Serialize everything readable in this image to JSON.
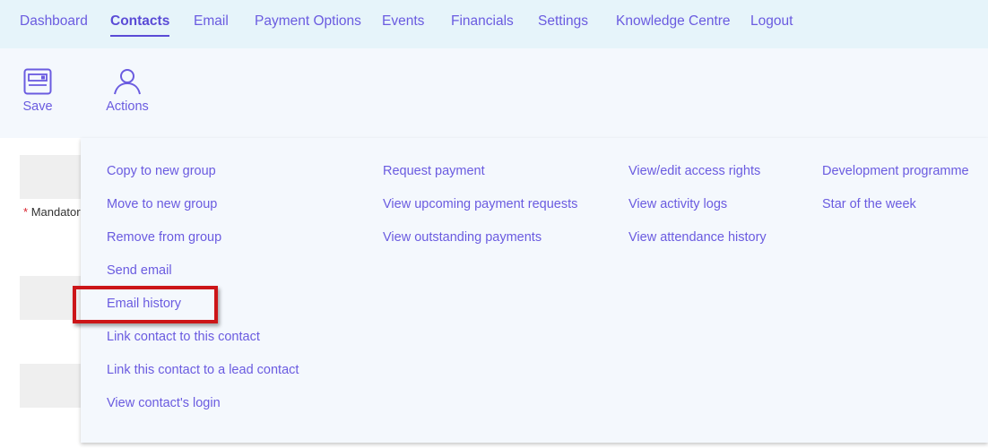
{
  "nav": {
    "dashboard": "Dashboard",
    "contacts": "Contacts",
    "email": "Email",
    "payment_options": "Payment Options",
    "events": "Events",
    "financials": "Financials",
    "settings": "Settings",
    "knowledge_centre": "Knowledge Centre",
    "logout": "Logout"
  },
  "toolbar": {
    "save_label": "Save",
    "actions_label": "Actions"
  },
  "form": {
    "mandatory_star": "*",
    "mandatory_label": "Mandatory"
  },
  "menu": {
    "col1": [
      "Copy to new group",
      "Move to new group",
      "Remove from group",
      "Send email",
      "Email history",
      "Link contact to this contact",
      "Link this contact to a lead contact",
      "View contact's login"
    ],
    "col2": [
      "Request payment",
      "View upcoming payment requests",
      "View outstanding payments"
    ],
    "col3": [
      "View/edit access rights",
      "View activity logs",
      "View attendance history"
    ],
    "col4": [
      "Development programme",
      "Star of the week"
    ]
  },
  "colors": {
    "accent": "#6a5be0",
    "nav_bg": "#e6f4fa",
    "panel_bg": "#f4f8fd",
    "highlight": "#cc1518"
  },
  "highlighted_item": "Email history"
}
